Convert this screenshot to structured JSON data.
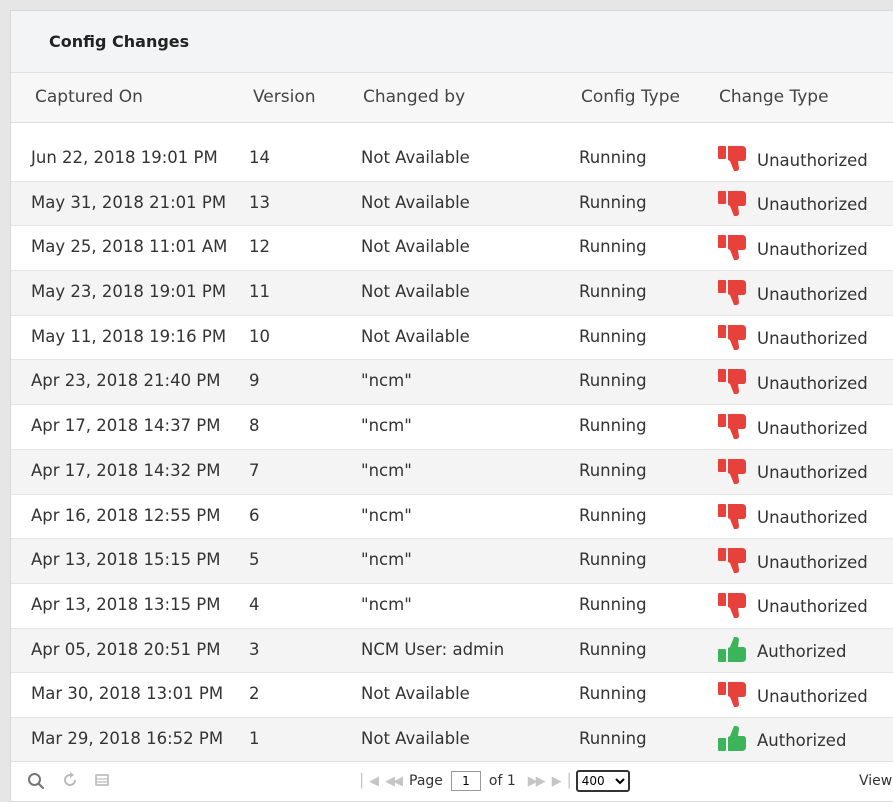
{
  "panel": {
    "title": "Config Changes"
  },
  "columns": {
    "captured_on": "Captured On",
    "version": "Version",
    "changed_by": "Changed by",
    "config_type": "Config Type",
    "change_type": "Change Type"
  },
  "rows": [
    {
      "captured_on": "Jun 22, 2018 19:01 PM",
      "version": "14",
      "changed_by": "Not Available",
      "config_type": "Running",
      "change_type": "Unauthorized",
      "icon": "thumbs-down-icon"
    },
    {
      "captured_on": "May 31, 2018 21:01 PM",
      "version": "13",
      "changed_by": "Not Available",
      "config_type": "Running",
      "change_type": "Unauthorized",
      "icon": "thumbs-down-icon"
    },
    {
      "captured_on": "May 25, 2018 11:01 AM",
      "version": "12",
      "changed_by": "Not Available",
      "config_type": "Running",
      "change_type": "Unauthorized",
      "icon": "thumbs-down-icon"
    },
    {
      "captured_on": "May 23, 2018 19:01 PM",
      "version": "11",
      "changed_by": "Not Available",
      "config_type": "Running",
      "change_type": "Unauthorized",
      "icon": "thumbs-down-icon"
    },
    {
      "captured_on": "May 11, 2018 19:16 PM",
      "version": "10",
      "changed_by": "Not Available",
      "config_type": "Running",
      "change_type": "Unauthorized",
      "icon": "thumbs-down-icon"
    },
    {
      "captured_on": "Apr 23, 2018 21:40 PM",
      "version": "9",
      "changed_by": "\"ncm\"",
      "config_type": "Running",
      "change_type": "Unauthorized",
      "icon": "thumbs-down-icon"
    },
    {
      "captured_on": "Apr 17, 2018 14:37 PM",
      "version": "8",
      "changed_by": "\"ncm\"",
      "config_type": "Running",
      "change_type": "Unauthorized",
      "icon": "thumbs-down-icon"
    },
    {
      "captured_on": "Apr 17, 2018 14:32 PM",
      "version": "7",
      "changed_by": "\"ncm\"",
      "config_type": "Running",
      "change_type": "Unauthorized",
      "icon": "thumbs-down-icon"
    },
    {
      "captured_on": "Apr 16, 2018 12:55 PM",
      "version": "6",
      "changed_by": "\"ncm\"",
      "config_type": "Running",
      "change_type": "Unauthorized",
      "icon": "thumbs-down-icon"
    },
    {
      "captured_on": "Apr 13, 2018 15:15 PM",
      "version": "5",
      "changed_by": "\"ncm\"",
      "config_type": "Running",
      "change_type": "Unauthorized",
      "icon": "thumbs-down-icon"
    },
    {
      "captured_on": "Apr 13, 2018 13:15 PM",
      "version": "4",
      "changed_by": "\"ncm\"",
      "config_type": "Running",
      "change_type": "Unauthorized",
      "icon": "thumbs-down-icon"
    },
    {
      "captured_on": "Apr 05, 2018 20:51 PM",
      "version": "3",
      "changed_by": "NCM User: admin",
      "config_type": "Running",
      "change_type": "Authorized",
      "icon": "thumbs-up-icon"
    },
    {
      "captured_on": "Mar 30, 2018 13:01 PM",
      "version": "2",
      "changed_by": "Not Available",
      "config_type": "Running",
      "change_type": "Unauthorized",
      "icon": "thumbs-down-icon"
    },
    {
      "captured_on": "Mar 29, 2018 16:52 PM",
      "version": "1",
      "changed_by": "Not Available",
      "config_type": "Running",
      "change_type": "Authorized",
      "icon": "thumbs-up-icon"
    }
  ],
  "colors": {
    "unauthorized": "#e8413c",
    "authorized": "#3cb55a"
  },
  "footer": {
    "page_label": "Page",
    "page_value": "1",
    "of_label": "of 1",
    "page_size": "400",
    "view_label": "View"
  }
}
